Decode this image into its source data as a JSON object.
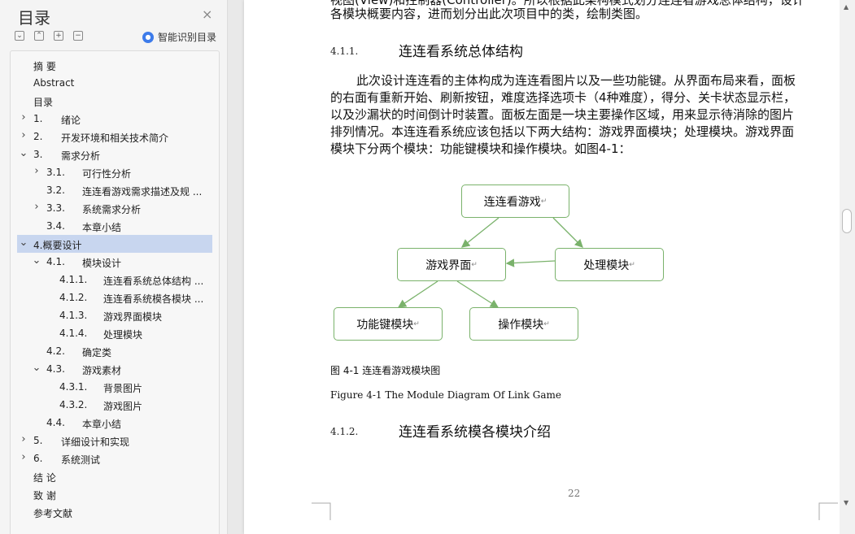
{
  "sidebar": {
    "title": "目录",
    "close": "×",
    "toolbar": [
      "⌄",
      "⌃",
      "+",
      "−"
    ],
    "smart_label": "智能识别目录",
    "toc": [
      {
        "num": "",
        "label": "摘   要",
        "arrow": "",
        "level": 0
      },
      {
        "num": "",
        "label": "Abstract",
        "arrow": "",
        "level": 0
      },
      {
        "num": "",
        "label": "目录",
        "arrow": "",
        "level": 0
      },
      {
        "num": "1.",
        "label": "绪论",
        "arrow": "›",
        "level": 0
      },
      {
        "num": "2.",
        "label": "开发环境和相关技术简介",
        "arrow": "›",
        "level": 0
      },
      {
        "num": "3.",
        "label": "需求分析",
        "arrow": "⌄",
        "level": 0
      },
      {
        "num": "3.1.",
        "label": "可行性分析",
        "arrow": "›",
        "level": 1
      },
      {
        "num": "3.2.",
        "label": "连连看游戏需求描述及规 ...",
        "arrow": "",
        "level": 1
      },
      {
        "num": "3.3.",
        "label": "系统需求分析",
        "arrow": "›",
        "level": 1
      },
      {
        "num": "3.4.",
        "label": "本章小结",
        "arrow": "",
        "level": 1
      },
      {
        "num": "",
        "label": "4.概要设计",
        "arrow": "⌄",
        "level": 0,
        "selected": true
      },
      {
        "num": "4.1.",
        "label": "模块设计",
        "arrow": "⌄",
        "level": 1
      },
      {
        "num": "4.1.1.",
        "label": "连连看系统总体结构  ...",
        "arrow": "",
        "level": 2
      },
      {
        "num": "4.1.2.",
        "label": "连连看系统模各模块 ...",
        "arrow": "",
        "level": 2
      },
      {
        "num": "4.1.3.",
        "label": "游戏界面模块",
        "arrow": "",
        "level": 2
      },
      {
        "num": "4.1.4.",
        "label": "处理模块",
        "arrow": "",
        "level": 2
      },
      {
        "num": "4.2.",
        "label": "确定类",
        "arrow": "",
        "level": 1
      },
      {
        "num": "4.3.",
        "label": "游戏素材",
        "arrow": "⌄",
        "level": 1
      },
      {
        "num": "4.3.1.",
        "label": "背景图片",
        "arrow": "",
        "level": 2
      },
      {
        "num": "4.3.2.",
        "label": "游戏图片",
        "arrow": "",
        "level": 2
      },
      {
        "num": "4.4.",
        "label": "本章小结",
        "arrow": "",
        "level": 1
      },
      {
        "num": "5.",
        "label": "详细设计和实现",
        "arrow": "›",
        "level": 0
      },
      {
        "num": "6.",
        "label": "系统测试",
        "arrow": "›",
        "level": 0
      },
      {
        "num": "",
        "label": "结   论",
        "arrow": "",
        "level": 0
      },
      {
        "num": "",
        "label": "致   谢",
        "arrow": "",
        "level": 0
      },
      {
        "num": "",
        "label": "参考文献",
        "arrow": "",
        "level": 0
      }
    ]
  },
  "doc": {
    "top_line1": "视图(View)和控制器(Controller)。所以根据此架构模式划分连连看游戏总体结构，设计",
    "top_line2": "各模块概要内容，进而划分出此次项目中的类，绘制类图。",
    "h1_num": "4.1.1.",
    "h1_text": "连连看系统总体结构",
    "para": [
      "此次设计连连看的主体构成为连连看图片以及一些功能键。从界面布局来看，面板",
      "的右面有重新开始、刷新按钮，难度选择选项卡（4种难度），得分、关卡状态显示栏，",
      "以及沙漏状的时间倒计时装置。面板左面是一块主要操作区域，用来显示待消除的图片",
      "排列情况。本连连看系统应该包括以下两大结构：游戏界面模块；处理模块。游戏界面",
      "模块下分两个模块：功能键模块和操作模块。如图4-1："
    ],
    "diagram": {
      "root": "连连看游戏",
      "ui": "游戏界面",
      "proc": "处理模块",
      "func": "功能键模块",
      "op": "操作模块",
      "mark": "↵"
    },
    "cap_cn": "图  4-1    连连看游戏模块图",
    "cap_en": "Figure 4-1     The Module Diagram Of Link Game",
    "h2_num": "4.1.2.",
    "h2_text": "连连看系统模各模块介绍",
    "page_number": "22"
  },
  "colors": {
    "accent": "#3d7bea",
    "selected": "#c8d6ef",
    "diagram_border": "#7ab26b"
  }
}
